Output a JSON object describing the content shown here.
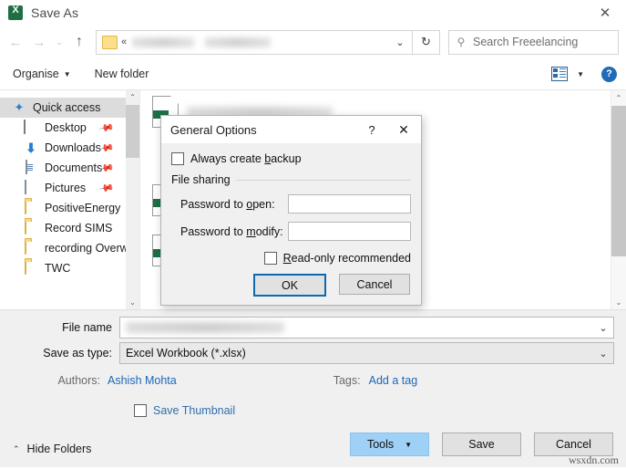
{
  "window": {
    "title": "Save As",
    "app_icon": "excel-icon",
    "close_label": "✕"
  },
  "nav": {
    "back": "←",
    "forward": "→",
    "recent": "⌄",
    "up": "↑",
    "address": {
      "folder_icon": "folder-icon",
      "overflow": "«",
      "crumb_1_redacted": "",
      "crumb_2_redacted": "",
      "caret": "⌄"
    },
    "refresh": "↻",
    "search": {
      "icon": "search-icon",
      "placeholder": "Search Freeelancing",
      "value": ""
    }
  },
  "command_bar": {
    "organise": "Organise",
    "organise_caret": "▼",
    "new_folder": "New folder",
    "view_icon": "view-layout-icon",
    "view_caret": "▼",
    "help": "?"
  },
  "sidebar": {
    "items": [
      {
        "label": "Quick access",
        "icon": "star-icon",
        "selected": true,
        "level": 1,
        "pinned": false
      },
      {
        "label": "Desktop",
        "icon": "desktop-icon",
        "selected": false,
        "level": 2,
        "pinned": true
      },
      {
        "label": "Downloads",
        "icon": "download-icon",
        "selected": false,
        "level": 2,
        "pinned": true
      },
      {
        "label": "Documents",
        "icon": "document-icon",
        "selected": false,
        "level": 2,
        "pinned": true
      },
      {
        "label": "Pictures",
        "icon": "picture-icon",
        "selected": false,
        "level": 2,
        "pinned": true
      },
      {
        "label": "PositiveEnergy",
        "icon": "folder-icon",
        "selected": false,
        "level": 2,
        "pinned": false
      },
      {
        "label": "Record SIMS",
        "icon": "folder-icon",
        "selected": false,
        "level": 2,
        "pinned": false
      },
      {
        "label": "recording Overw",
        "icon": "folder-icon",
        "selected": false,
        "level": 2,
        "pinned": false
      },
      {
        "label": "TWC",
        "icon": "folder-icon",
        "selected": false,
        "level": 2,
        "pinned": false
      }
    ],
    "scroll_up": "⌃",
    "scroll_down": "⌄",
    "pin_glyph": "✒"
  },
  "file_list": {
    "items": [
      {
        "icon": "excel-file-icon",
        "name_redacted": ""
      },
      {
        "icon": "excel-file-icon",
        "name_redacted": ""
      },
      {
        "icon": "excel-file-icon",
        "name_redacted": ""
      }
    ],
    "scroll_up": "⌃",
    "scroll_down": "⌄"
  },
  "dialog": {
    "title": "General Options",
    "help_button": "?",
    "close_button": "✕",
    "always_create_backup": {
      "label_pre": "Always create ",
      "label_accel": "b",
      "label_post": "ackup",
      "checked": false
    },
    "file_sharing_group": "File sharing",
    "password_to_open": {
      "label_pre": "Password to ",
      "label_accel": "o",
      "label_post": "pen:",
      "value": ""
    },
    "password_to_modify": {
      "label_pre": "Password to ",
      "label_accel": "m",
      "label_post": "odify:",
      "value": ""
    },
    "read_only_recommended": {
      "label_accel": "R",
      "label_post": "ead-only recommended",
      "checked": false
    },
    "ok_label": "OK",
    "cancel_label": "Cancel",
    "focus_color": "#0d6ab0"
  },
  "form": {
    "file_name_label": "File name",
    "file_name_value_redacted": "",
    "save_as_type_label": "Save as type:",
    "save_as_type_value": "Excel Workbook (*.xlsx)",
    "combo_caret": "⌄",
    "authors_label": "Authors:",
    "authors_value": "Ashish Mohta",
    "tags_label": "Tags:",
    "tags_value": "Add a tag",
    "save_thumbnail_label": "Save Thumbnail",
    "save_thumbnail_checked": false
  },
  "footer": {
    "hide_folders": "Hide Folders",
    "hide_folders_caret": "⌃",
    "tools_label": "Tools",
    "tools_caret": "▼",
    "save_label": "Save",
    "cancel_label": "Cancel"
  },
  "watermark": "wsxdn.com",
  "colors": {
    "accent_blue": "#0d6ab0",
    "link_blue": "#1a68b8",
    "excel_green": "#1d7044",
    "tools_highlight": "#9fd0f5"
  }
}
